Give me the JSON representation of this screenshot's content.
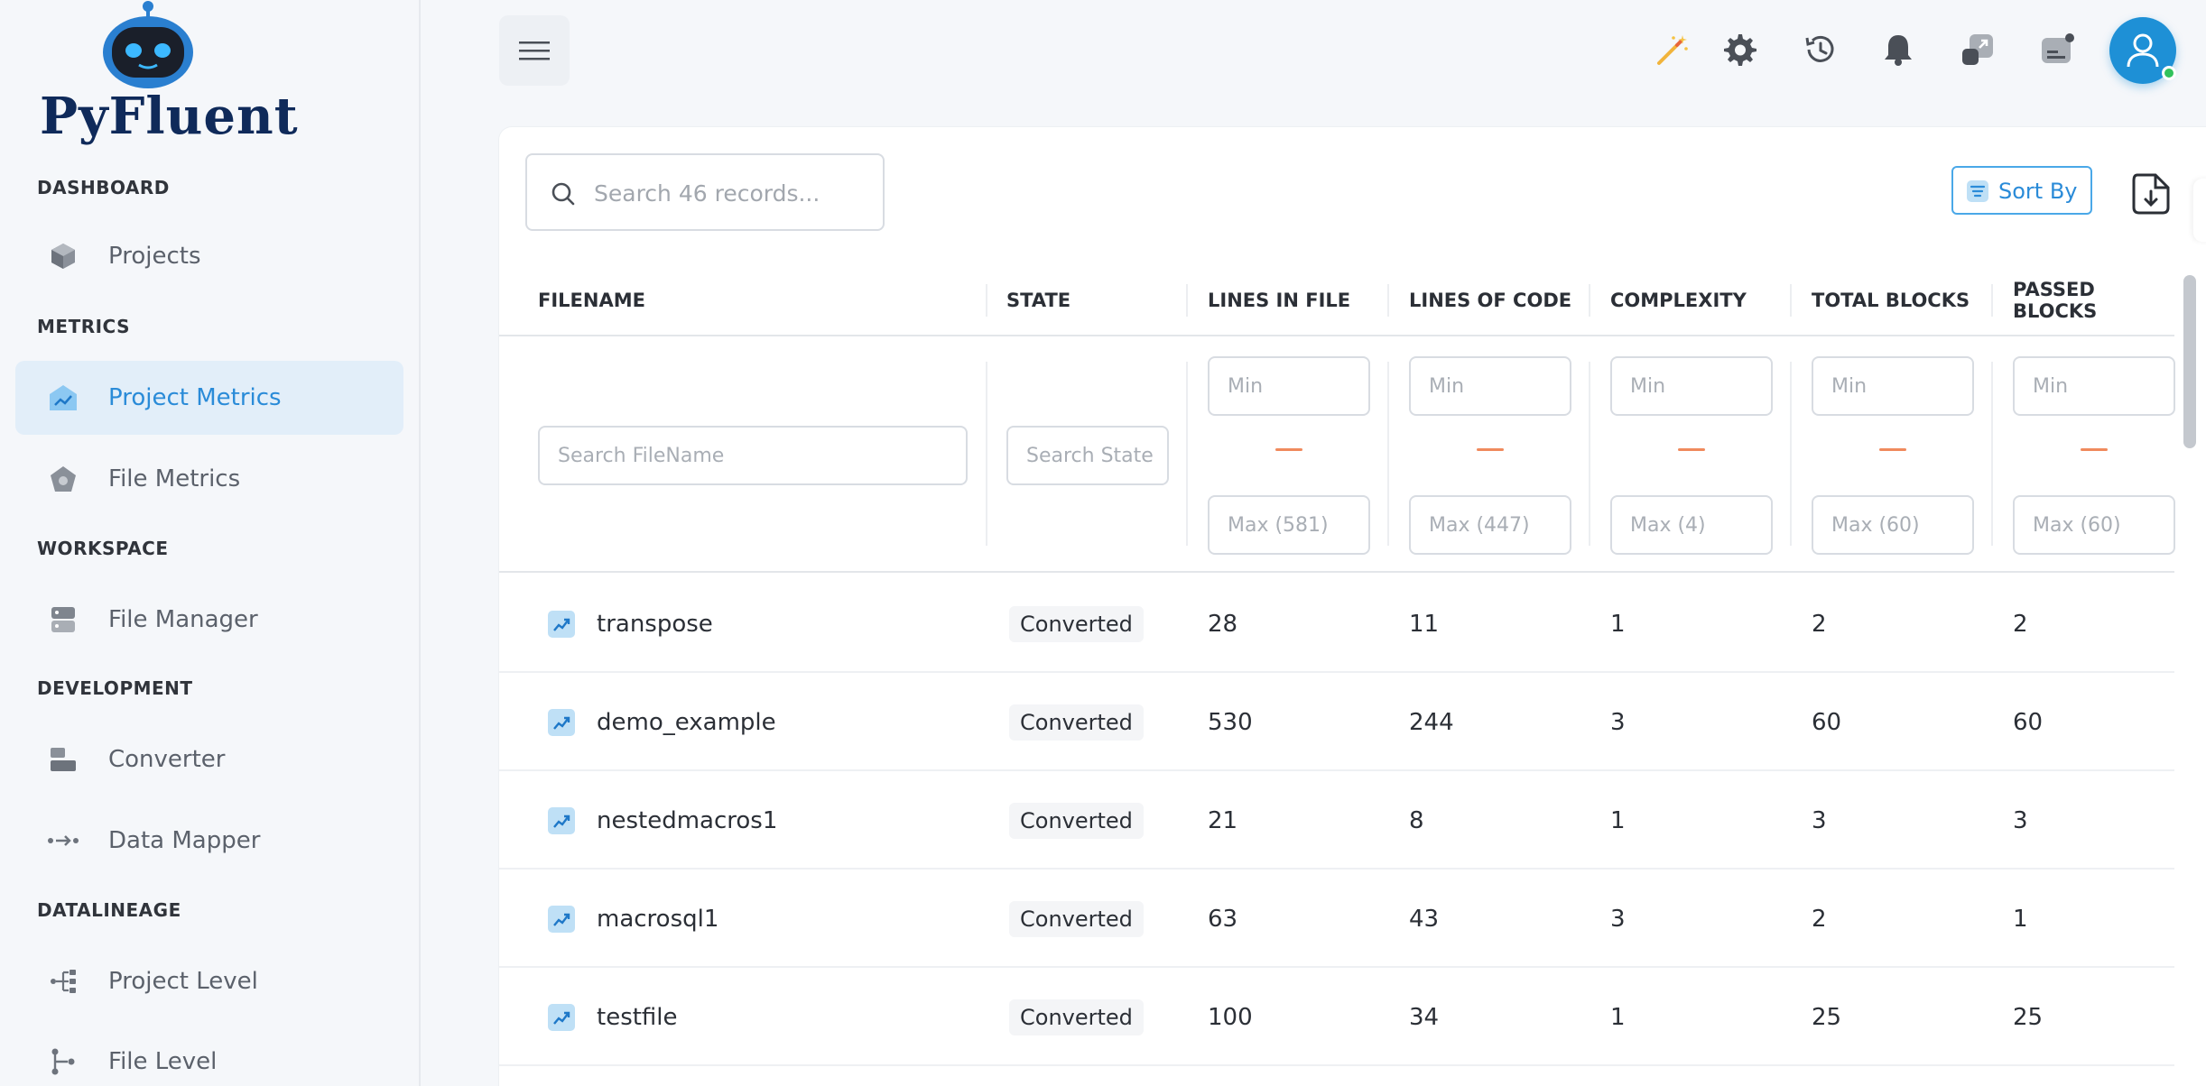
{
  "brand": {
    "name": "PyFluent"
  },
  "sidebar": {
    "sections": [
      {
        "title": "DASHBOARD",
        "items": [
          {
            "label": "Projects",
            "icon": "cube-icon"
          }
        ]
      },
      {
        "title": "METRICS",
        "items": [
          {
            "label": "Project Metrics",
            "icon": "chart-house-icon",
            "active": true
          },
          {
            "label": "File Metrics",
            "icon": "pentagon-icon"
          }
        ]
      },
      {
        "title": "WORKSPACE",
        "items": [
          {
            "label": "File Manager",
            "icon": "server-icon"
          }
        ]
      },
      {
        "title": "DEVELOPMENT",
        "items": [
          {
            "label": "Converter",
            "icon": "blocks-icon"
          },
          {
            "label": "Data Mapper",
            "icon": "arrow-dots-icon"
          }
        ]
      },
      {
        "title": "DATALINEAGE",
        "items": [
          {
            "label": "Project Level",
            "icon": "tree-icon"
          },
          {
            "label": "File Level",
            "icon": "branch-icon"
          }
        ]
      }
    ]
  },
  "topbar": {
    "icons": [
      "magic-wand-icon",
      "gear-icon",
      "history-icon",
      "bell-icon",
      "expand-icon",
      "message-icon",
      "user-avatar-icon"
    ],
    "accent": "#1e90d6"
  },
  "toolbar": {
    "search_placeholder": "Search 46 records...",
    "sort_label": "Sort By"
  },
  "table": {
    "columns": [
      "FILENAME",
      "STATE",
      "LINES IN FILE",
      "LINES OF CODE",
      "COMPLEXITY",
      "TOTAL BLOCKS",
      "PASSED BLOCKS"
    ],
    "filters": {
      "filename_placeholder": "Search FileName",
      "state_placeholder": "Search State",
      "min_placeholder": "Min",
      "max_placeholders": [
        "Max (581)",
        "Max (447)",
        "Max (4)",
        "Max (60)",
        "Max (60)"
      ]
    },
    "rows": [
      {
        "filename": "transpose",
        "state": "Converted",
        "lines_in_file": "28",
        "lines_of_code": "11",
        "complexity": "1",
        "total_blocks": "2",
        "passed_blocks": "2"
      },
      {
        "filename": "demo_example",
        "state": "Converted",
        "lines_in_file": "530",
        "lines_of_code": "244",
        "complexity": "3",
        "total_blocks": "60",
        "passed_blocks": "60"
      },
      {
        "filename": "nestedmacros1",
        "state": "Converted",
        "lines_in_file": "21",
        "lines_of_code": "8",
        "complexity": "1",
        "total_blocks": "3",
        "passed_blocks": "3"
      },
      {
        "filename": "macrosql1",
        "state": "Converted",
        "lines_in_file": "63",
        "lines_of_code": "43",
        "complexity": "3",
        "total_blocks": "2",
        "passed_blocks": "1"
      },
      {
        "filename": "testfile",
        "state": "Converted",
        "lines_in_file": "100",
        "lines_of_code": "34",
        "complexity": "1",
        "total_blocks": "25",
        "passed_blocks": "25"
      }
    ]
  }
}
